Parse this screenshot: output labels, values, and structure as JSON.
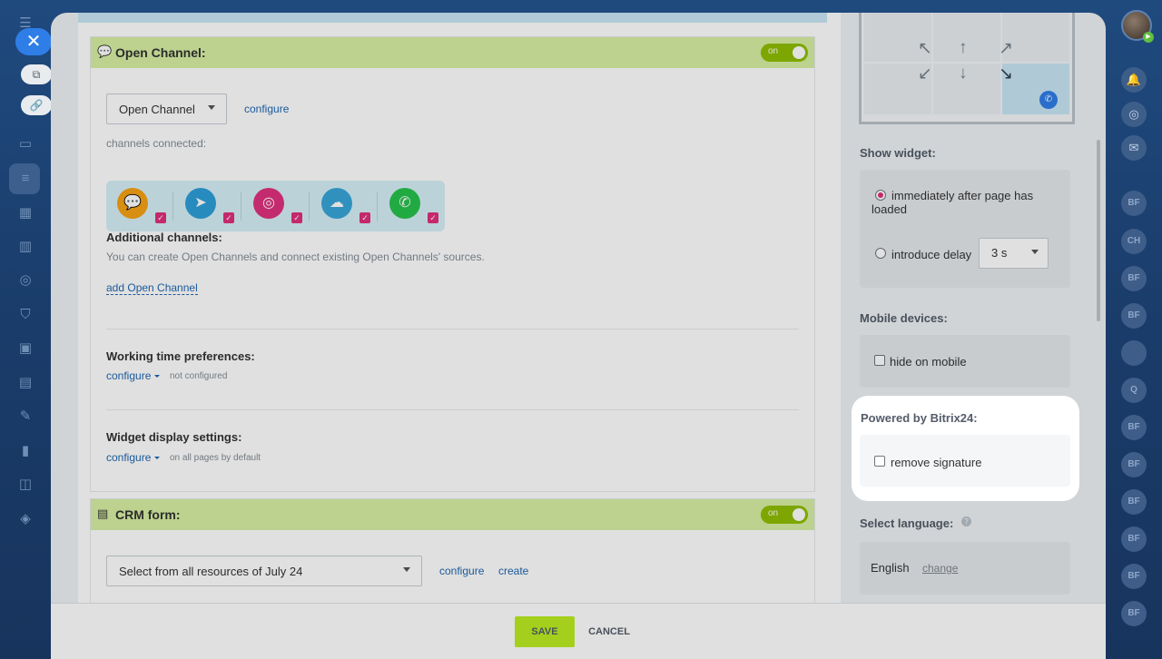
{
  "open_channel": {
    "title": "Open Channel:",
    "toggle_label": "on",
    "select_value": "Open Channel",
    "configure_link": "configure",
    "channels_connected_label": "channels connected:",
    "channels": [
      {
        "name": "chat-icon",
        "color": "#f5a214"
      },
      {
        "name": "telegram-icon",
        "color": "#2d9fd9"
      },
      {
        "name": "instagram-icon",
        "color": "#e0317e"
      },
      {
        "name": "cloud-icon",
        "color": "#37a5d9"
      },
      {
        "name": "whatsapp-icon",
        "color": "#27c24c"
      }
    ],
    "additional_title": "Additional channels:",
    "additional_text": "You can create Open Channels and connect existing Open Channels' sources.",
    "add_link": "add Open Channel",
    "working_time_title": "Working time preferences:",
    "working_time_link": "configure",
    "working_time_status": "not configured",
    "display_title": "Widget display settings:",
    "display_link": "configure",
    "display_status": "on all pages by default"
  },
  "crm_form": {
    "title": "CRM form:",
    "toggle_label": "on",
    "select_value": "Select from all resources of July 24",
    "configure_link": "configure",
    "create_link": "create"
  },
  "settings": {
    "show_widget_label": "Show widget:",
    "immediately_label": "immediately after page has loaded",
    "delay_label": "introduce delay",
    "delay_value": "3 s",
    "mobile_label": "Mobile devices:",
    "hide_mobile_label": "hide on mobile",
    "powered_label": "Powered by Bitrix24:",
    "remove_signature_label": "remove signature",
    "language_label": "Select language:",
    "language_value": "English",
    "change_link": "change"
  },
  "footer": {
    "save_label": "SAVE",
    "cancel_label": "CANCEL"
  },
  "right_rail": {
    "bubbles": [
      "BF",
      "CH",
      "BF",
      "BF",
      "",
      "Q",
      "BF",
      "BF",
      "BF",
      "BF",
      "BF",
      "BF"
    ]
  },
  "colors": {
    "accent_green": "#bbed21",
    "section_header": "#d6efa2",
    "link": "#2067b0",
    "radio_selected": "#e02f7a"
  }
}
